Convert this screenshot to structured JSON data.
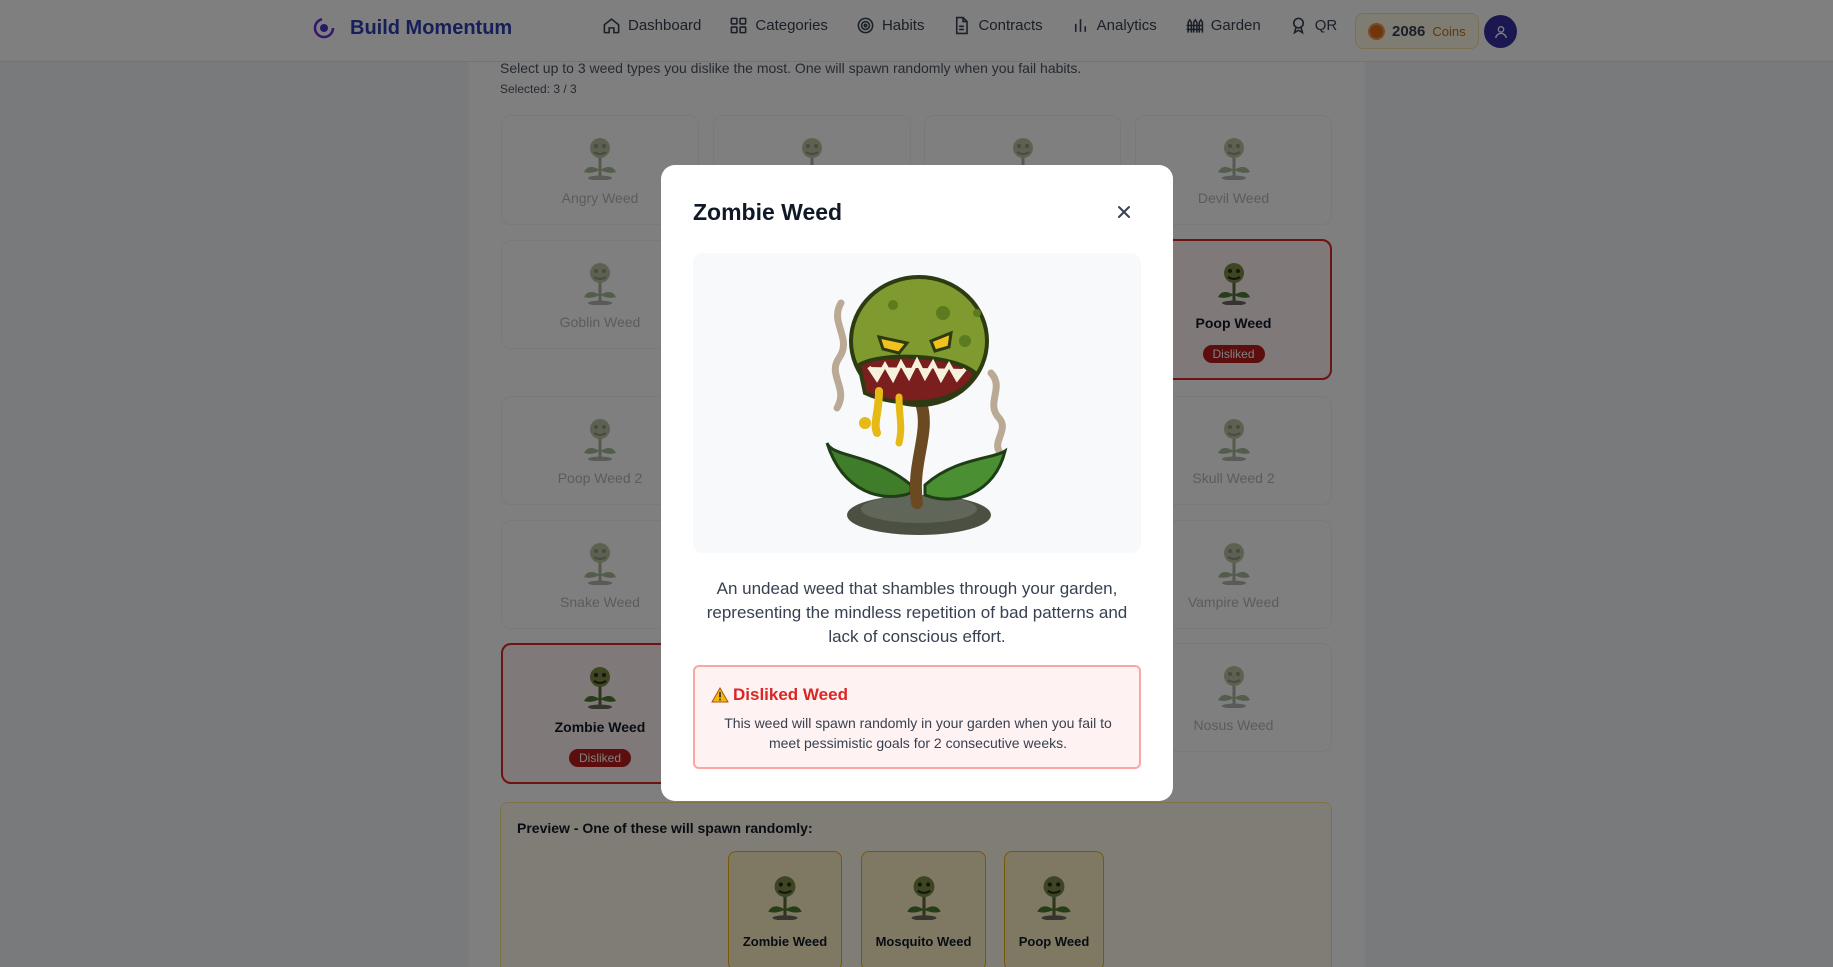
{
  "nav": {
    "brand": "Build Momentum",
    "items": [
      {
        "label": "Dashboard",
        "icon": "home-icon"
      },
      {
        "label": "Categories",
        "icon": "grid-icon"
      },
      {
        "label": "Habits",
        "icon": "target-icon"
      },
      {
        "label": "Contracts",
        "icon": "document-icon"
      },
      {
        "label": "Analytics",
        "icon": "bar-chart-icon"
      },
      {
        "label": "Garden",
        "icon": "fence-icon"
      },
      {
        "label": "QR",
        "icon": "qr-pin-icon"
      }
    ],
    "coins_value": "2086",
    "coins_label": "Coins"
  },
  "page": {
    "intro": "Select up to 3 weed types you dislike the most. One will spawn randomly when you fail habits.",
    "selected": "Selected: 3 / 3",
    "weeds": {
      "angry": "Angry Weed",
      "devil": "Devil Weed",
      "goblin": "Goblin Weed",
      "poop": "Poop Weed",
      "poop2": "Poop Weed 2",
      "skull2": "Skull Weed 2",
      "snake": "Snake Weed",
      "vampire": "Vampire Weed",
      "zombie": "Zombie Weed",
      "nosus": "Nosus Weed"
    },
    "disliked_badge": "Disliked",
    "preview_title": "Preview - One of these will spawn randomly:",
    "preview": [
      "Zombie Weed",
      "Mosquito Weed",
      "Poop Weed"
    ]
  },
  "modal": {
    "title": "Zombie Weed",
    "description": "An undead weed that shambles through your garden, representing the mindless repetition of bad patterns and lack of conscious effort.",
    "warning_title": "Disliked Weed",
    "warning_text": "This weed will spawn randomly in your garden when you fail to meet pessimistic goals for 2 consecutive weeks."
  },
  "colors": {
    "brand": "#2d3fb3",
    "disliked": "#dc2626",
    "preview_border": "#eab308"
  }
}
